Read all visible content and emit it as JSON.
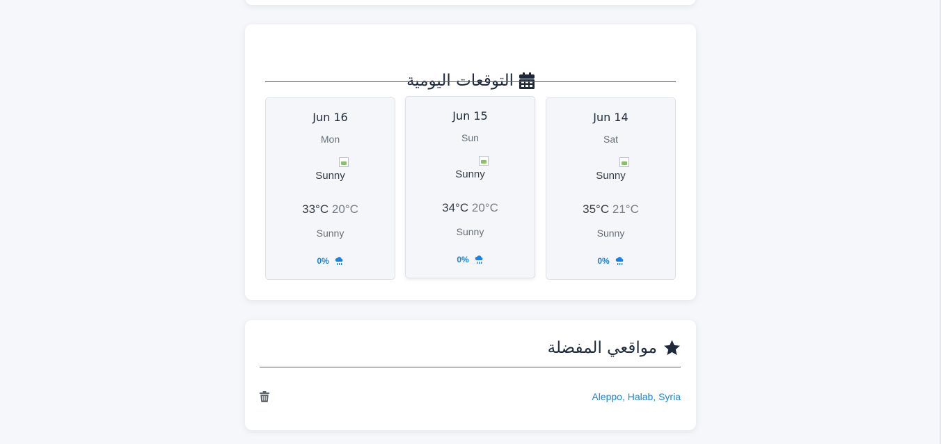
{
  "forecast": {
    "title": "التوقعات اليومية",
    "icon": "calendar-icon",
    "days": [
      {
        "date": "Jun 16",
        "weekday": "Mon",
        "icon_alt": "Sunny",
        "max": "33°C",
        "min": "20°C",
        "condition": "Sunny",
        "rain": "0%"
      },
      {
        "date": "Jun 15",
        "weekday": "Sun",
        "icon_alt": "Sunny",
        "max": "34°C",
        "min": "20°C",
        "condition": "Sunny",
        "rain": "0%"
      },
      {
        "date": "Jun 14",
        "weekday": "Sat",
        "icon_alt": "Sunny",
        "max": "35°C",
        "min": "21°C",
        "condition": "Sunny",
        "rain": "0%"
      }
    ]
  },
  "favorites": {
    "title": "مواقعي المفضلة",
    "icon": "star-icon",
    "items": [
      {
        "label": "Aleppo, Halab, Syria",
        "delete_icon": "trash-icon"
      }
    ]
  },
  "colors": {
    "accent": "#1a82e2",
    "rule": "#1a6fb3",
    "text": "#1e2a3b",
    "background": "#f5f7fa"
  }
}
